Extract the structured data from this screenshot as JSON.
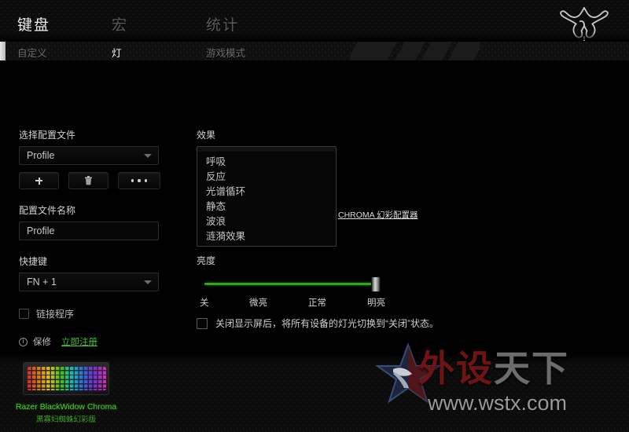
{
  "app": {
    "main_tabs": [
      {
        "label": "键盘",
        "active": true
      },
      {
        "label": "宏",
        "active": false
      },
      {
        "label": "统计",
        "active": false
      }
    ],
    "sub_tabs": [
      {
        "label": "自定义",
        "active": false
      },
      {
        "label": "灯",
        "active": true
      },
      {
        "label": "游戏模式",
        "active": false
      }
    ],
    "logo": "razer-logo"
  },
  "left_panel": {
    "select_profile_label": "选择配置文件",
    "profile_select_value": "Profile",
    "buttons": [
      {
        "name": "add-profile",
        "icon": "plus-icon"
      },
      {
        "name": "delete-profile",
        "icon": "trash-icon"
      },
      {
        "name": "more-profile",
        "icon": "ellipsis-icon"
      }
    ],
    "profile_name_label": "配置文件名称",
    "profile_name_value": "Profile",
    "shortcut_label": "快捷键",
    "shortcut_value": "FN + 1",
    "link_program_label": "链接程序",
    "link_program_checked": false
  },
  "warranty": {
    "icon": "info-icon",
    "label": "保修",
    "link": "立即注册",
    "link_color": "#3fbf2a"
  },
  "effects": {
    "label": "效果",
    "selected": "波浪",
    "options": [
      "呼吸",
      "反应",
      "光谱循环",
      "静态",
      "波浪",
      "涟漪效果"
    ],
    "dropdown_open": true,
    "chroma_link": "CHROMA 幻彩配置器"
  },
  "brightness": {
    "label": "亮度",
    "ticks": [
      "关",
      "微亮",
      "正常",
      "明亮"
    ],
    "value_percent": 100,
    "track_color": "#2faa16"
  },
  "dim_option": {
    "label": "关闭显示屏后，将所有设备的灯光切换到“关闭”状态。",
    "checked": false
  },
  "device": {
    "name": "Razer BlackWidow Chroma",
    "name_cn": "黑寡妇蜘蛛幻彩版",
    "name_color": "#4fd32a",
    "thumbnail": "keyboard-thumbnail"
  },
  "watermark": {
    "text_red": "外设",
    "text_gray": "天下",
    "url": "www.wstx.com",
    "star": "star-logo"
  }
}
